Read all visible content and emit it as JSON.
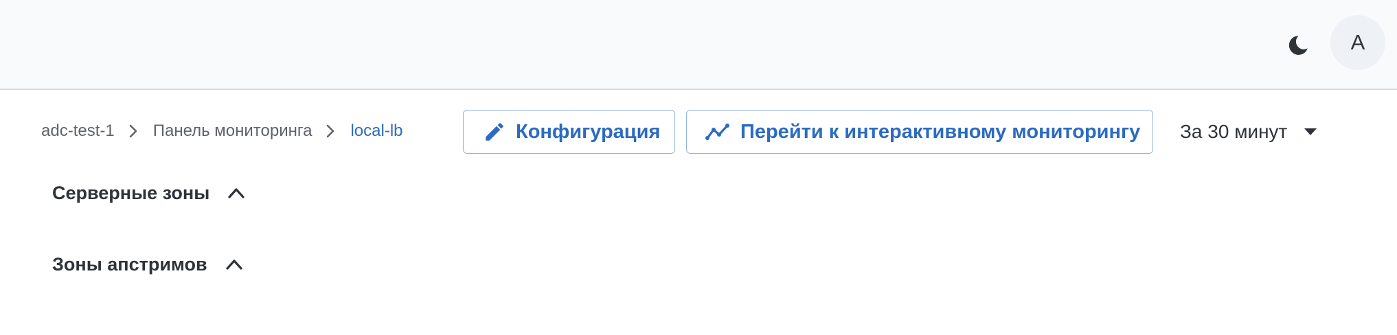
{
  "header": {
    "theme_icon": "moon-icon",
    "avatar_letter": "A"
  },
  "breadcrumb": {
    "items": [
      "adc-test-1",
      "Панель мониторинга",
      "local-lb"
    ],
    "separator_icon": "chevron-right-icon"
  },
  "toolbar": {
    "config_label": "Конфигурация",
    "config_icon": "pencil-icon",
    "monitor_label": "Перейти к интерактивному мониторингу",
    "monitor_icon": "chart-line-icon",
    "time_range_value": "За 30 минут",
    "time_range_icon": "caret-down-icon"
  },
  "sections": [
    {
      "title": "Серверные зоны",
      "icon": "chevron-up-icon"
    },
    {
      "title": "Зоны апстримов",
      "icon": "chevron-up-icon"
    }
  ],
  "colors": {
    "accent": "#2b6bc1",
    "button_border": "#8fb6e4",
    "topbar_bg": "#f9fafc",
    "text": "#2e3338"
  }
}
